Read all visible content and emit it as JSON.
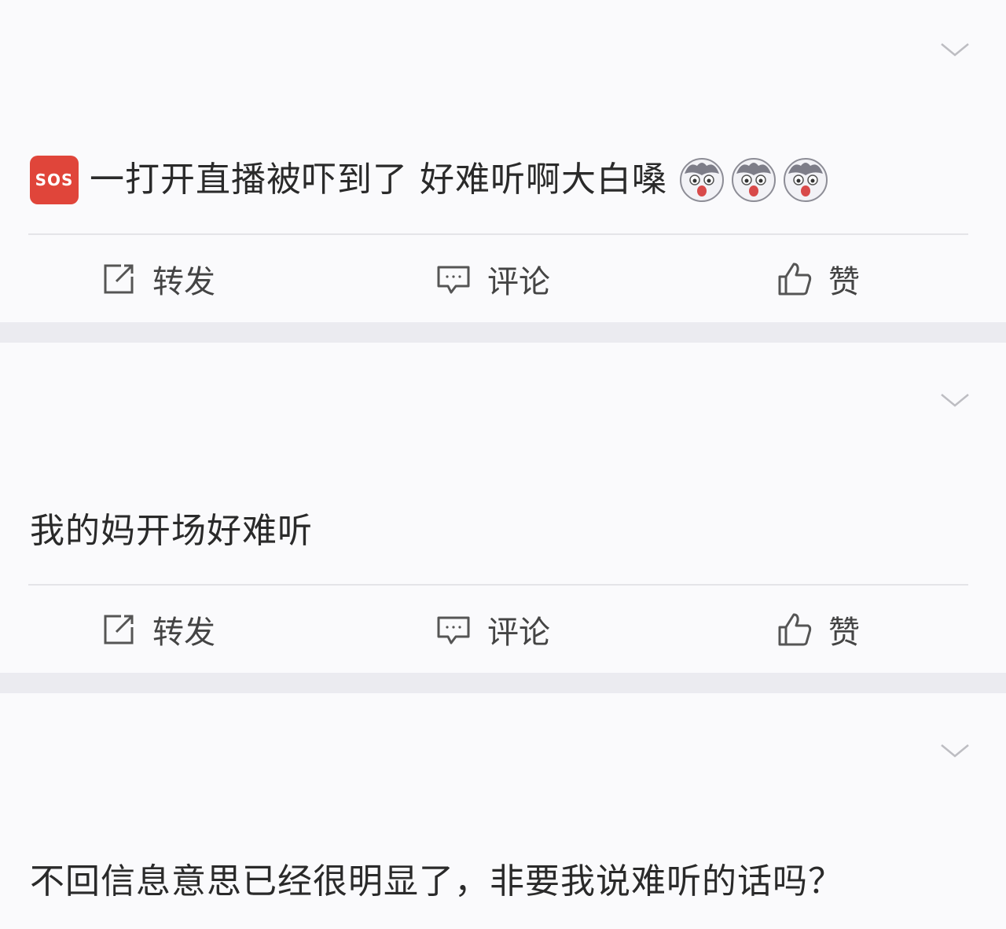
{
  "posts": [
    {
      "text": "一打开直播被吓到了 好难听啊大白嗓",
      "leading_badge": "SOS",
      "trailing_emoji": [
        "husky-emoji",
        "husky-emoji",
        "husky-emoji"
      ],
      "actions": {
        "repost": "转发",
        "comment": "评论",
        "like": "赞"
      }
    },
    {
      "text": "我的妈开场好难听",
      "actions": {
        "repost": "转发",
        "comment": "评论",
        "like": "赞"
      }
    },
    {
      "text": "不回信息意思已经很明显了，非要我说难听的话吗？"
    }
  ],
  "colors": {
    "page_bg": "#ebebf0",
    "card_bg": "#fafafc",
    "sos_red": "#e0453a",
    "text": "#2a2a2a"
  }
}
